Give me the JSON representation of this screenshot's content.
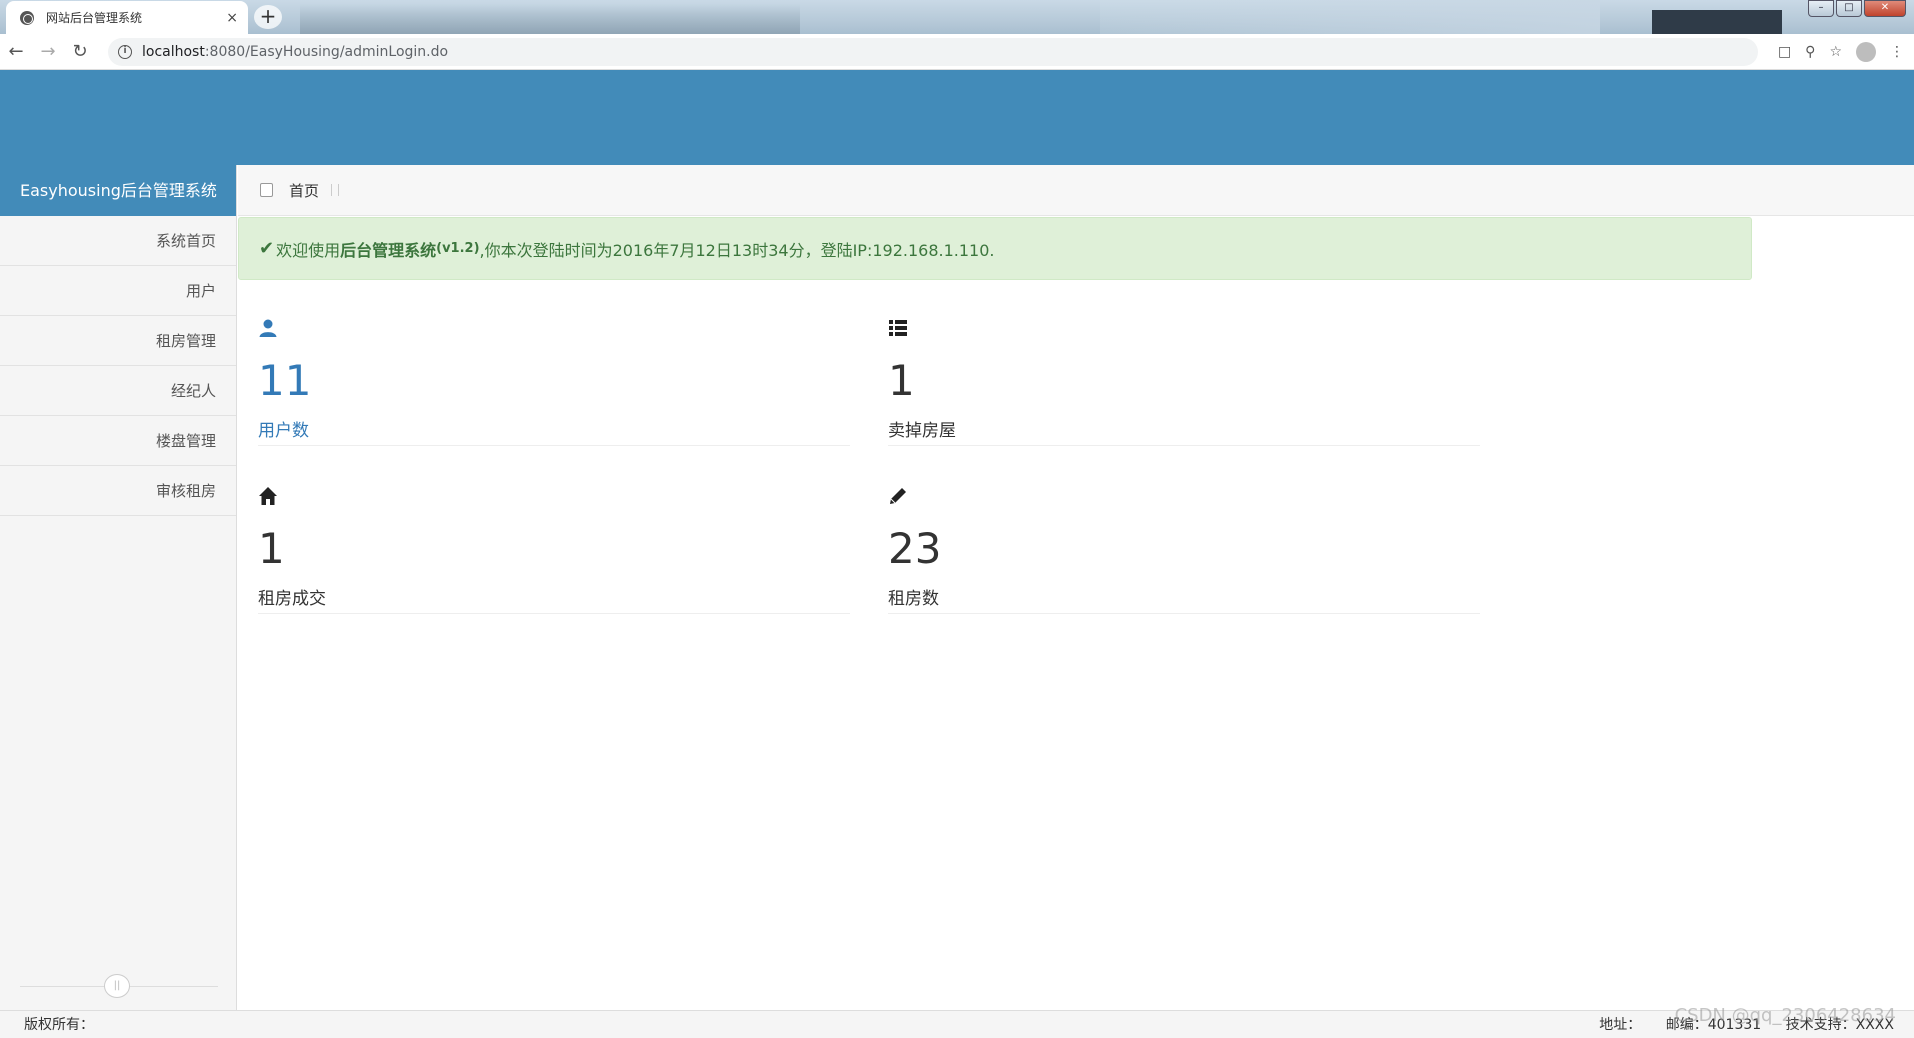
{
  "browser": {
    "tab_title": "网站后台管理系统",
    "tab_close": "×",
    "new_tab": "+",
    "url_host": "localhost",
    "url_path": ":8080/EasyHousing/adminLogin.do",
    "win_min": "–",
    "win_max": "□",
    "win_close": "✕"
  },
  "sidebar": {
    "brand": "Easyhousing后台管理系统",
    "items": [
      {
        "label": "系统首页"
      },
      {
        "label": "用户"
      },
      {
        "label": "租房管理"
      },
      {
        "label": "经纪人"
      },
      {
        "label": "楼盘管理"
      },
      {
        "label": "审核租房"
      }
    ]
  },
  "breadcrumb": {
    "home": "首页"
  },
  "alert": {
    "check": "✔",
    "prefix": "欢迎使用",
    "system_name": "后台管理系统",
    "version": "(v1.2)",
    "suffix": ",你本次登陆时间为2016年7月12日13时34分，登陆IP:192.168.1.110."
  },
  "stats": [
    {
      "icon": "user-icon",
      "value": "11",
      "label": "用户数"
    },
    {
      "icon": "list-icon",
      "value": "1",
      "label": "卖掉房屋"
    },
    {
      "icon": "home-icon",
      "value": "1",
      "label": "租房成交"
    },
    {
      "icon": "pencil-icon",
      "value": "23",
      "label": "租房数"
    }
  ],
  "colors": {
    "primary": "#428bb9",
    "link": "#337ab7",
    "alert_bg": "#dff0d8",
    "alert_text": "#3c763d"
  },
  "footer": {
    "copyright": "版权所有：",
    "address": "地址：",
    "postcode": "邮编：401331",
    "support": "技术支持：XXXX"
  },
  "watermark": "CSDN @qq_2306428634"
}
